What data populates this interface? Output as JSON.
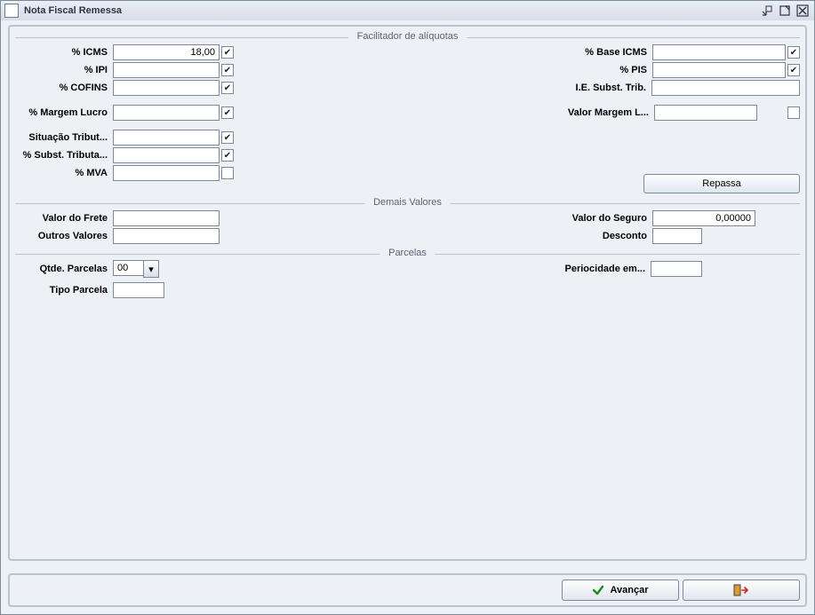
{
  "window": {
    "title": "Nota Fiscal Remessa"
  },
  "sections": {
    "aliquotas": {
      "title": "Facilitador de alíquotas"
    },
    "demais": {
      "title": "Demais Valores"
    },
    "parcelas": {
      "title": "Parcelas"
    }
  },
  "aliquotas": {
    "left": {
      "icms": {
        "label": "% ICMS",
        "value": "18,00",
        "checked": true
      },
      "ipi": {
        "label": "% IPI",
        "value": "",
        "checked": true
      },
      "cofins": {
        "label": "% COFINS",
        "value": "",
        "checked": true
      },
      "margem": {
        "label": "% Margem Lucro",
        "value": "",
        "checked": true
      },
      "sit_trib": {
        "label": "Situação Tribut...",
        "value": "",
        "checked": true
      },
      "subst_trib": {
        "label": "% Subst. Tributa...",
        "value": "",
        "checked": true
      },
      "mva": {
        "label": "% MVA",
        "value": "",
        "checked": false
      }
    },
    "right": {
      "base_icms": {
        "label": "% Base ICMS",
        "value": "",
        "checked": true
      },
      "pis": {
        "label": "% PIS",
        "value": "",
        "checked": true
      },
      "ie_subst": {
        "label": "I.E. Subst. Trib.",
        "value": ""
      },
      "valor_margem": {
        "label": "Valor Margem L...",
        "value": "",
        "checked": false
      },
      "repassa_btn": "Repassa"
    }
  },
  "demais": {
    "frete": {
      "label": "Valor do Frete",
      "value": ""
    },
    "outros": {
      "label": "Outros Valores",
      "value": ""
    },
    "seguro": {
      "label": "Valor do Seguro",
      "value": "0,00000"
    },
    "desconto": {
      "label": "Desconto",
      "value": ""
    }
  },
  "parcelas": {
    "qtde": {
      "label": "Qtde. Parcelas",
      "value": "00"
    },
    "tipo": {
      "label": "Tipo Parcela",
      "value": ""
    },
    "period": {
      "label": "Periocidade em...",
      "value": ""
    }
  },
  "footer": {
    "avancar": "Avançar"
  },
  "glyphs": {
    "check": "✔",
    "drop": "▾"
  }
}
